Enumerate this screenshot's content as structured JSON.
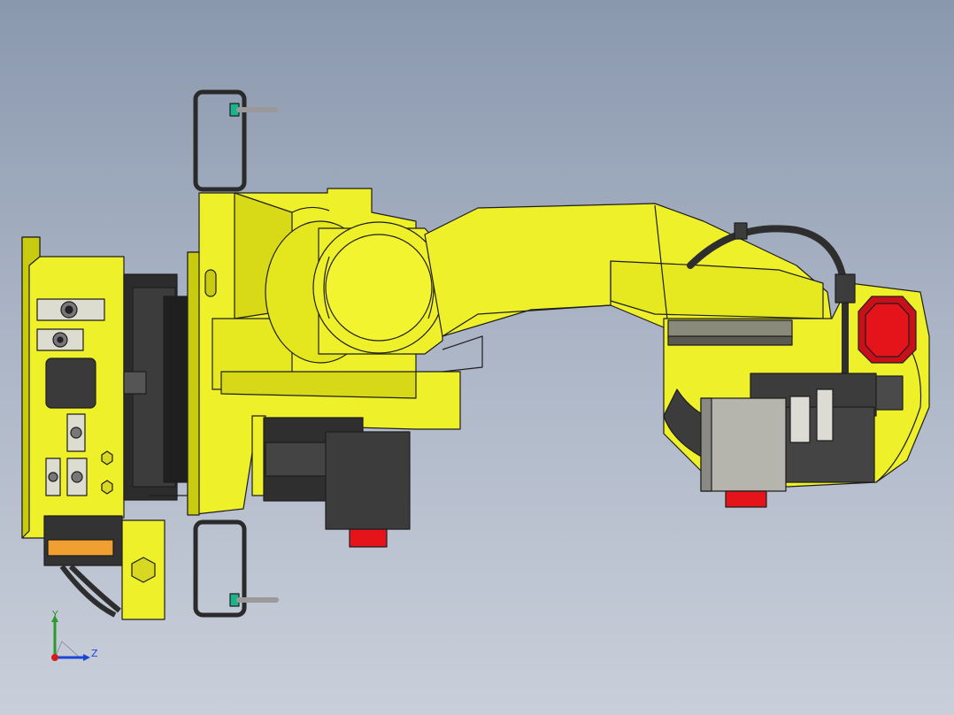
{
  "viewport": {
    "background_top": "#8a98ae",
    "background_bottom": "#c9cfda"
  },
  "model": {
    "name": "robot-arm-side-view",
    "body_color": "#eef02a",
    "shade_color": "#c9cb10",
    "dark_part_color": "#3c3c3c",
    "red_part_color": "#e5141a",
    "orange_part_color": "#f0a030",
    "cable_color": "#2e2e2e",
    "gray_part_color": "#b5b5ad"
  },
  "triad": {
    "y_label": "Y",
    "z_label": "Z",
    "y_color": "#2a9a2a",
    "z_color": "#1a46d8",
    "x_color": "#d81a1a"
  }
}
